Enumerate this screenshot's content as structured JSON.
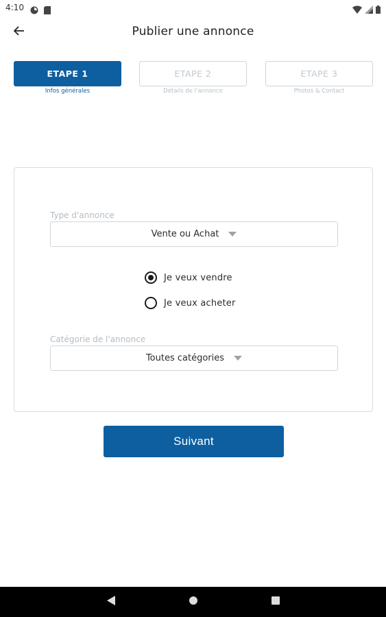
{
  "status": {
    "time": "4:10",
    "icons": [
      "app-notification-icon",
      "sd-card-icon",
      "wifi-icon",
      "signal-icon",
      "battery-icon"
    ]
  },
  "header": {
    "title": "Publier une annonce",
    "back_icon": "arrow-left-icon"
  },
  "steps": [
    {
      "label": "ETAPE 1",
      "sublabel": "Infos générales",
      "active": true
    },
    {
      "label": "ETAPE 2",
      "sublabel": "Détails de l'annonce",
      "active": false
    },
    {
      "label": "ETAPE 3",
      "sublabel": "Photos & Contact",
      "active": false
    }
  ],
  "form": {
    "type_label": "Type d'annonce",
    "type_value": "Vente ou Achat",
    "options": [
      {
        "label": "Je veux vendre",
        "selected": true
      },
      {
        "label": "Je veux acheter",
        "selected": false
      }
    ],
    "category_label": "Catégorie de l'annonce",
    "category_value": "Toutes catégories"
  },
  "actions": {
    "next_label": "Suivant"
  },
  "colors": {
    "primary": "#0d5fa0",
    "border": "#cfd6dc",
    "muted_text": "#b4bcc3"
  },
  "nav": {
    "icons": [
      "back-triangle-icon",
      "home-circle-icon",
      "recents-square-icon"
    ]
  }
}
